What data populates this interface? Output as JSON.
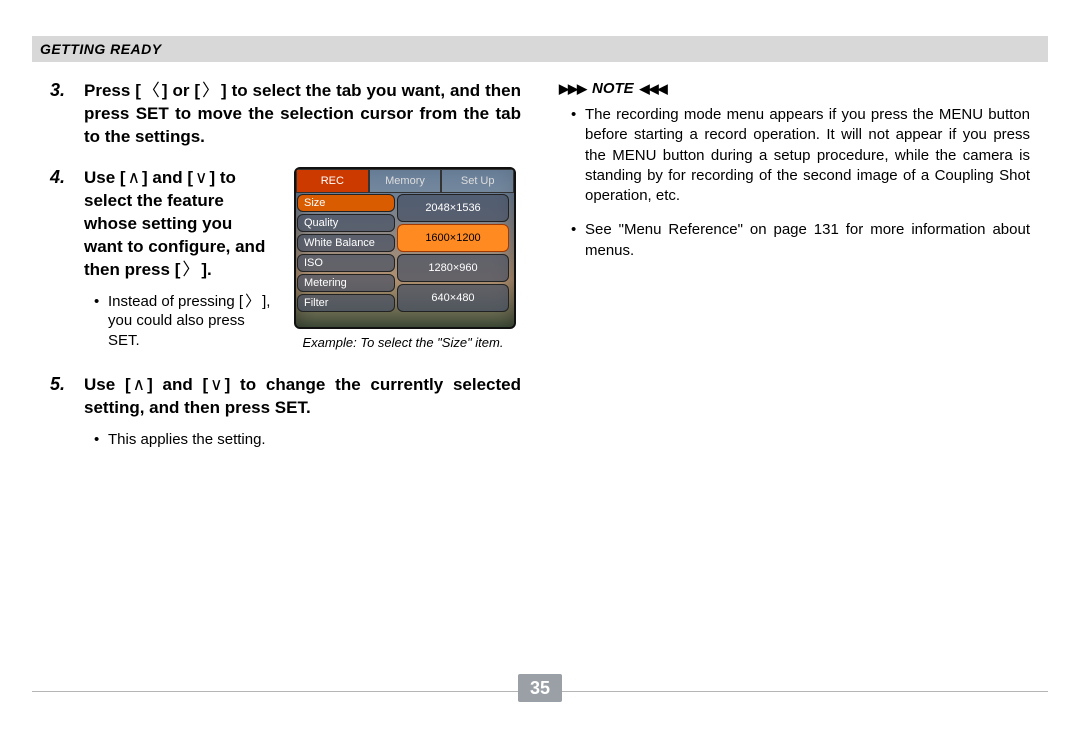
{
  "header": {
    "section_title": "GETTING READY"
  },
  "left": {
    "step3": {
      "num": "3.",
      "text_a": "Press [",
      "text_b": "] or [",
      "text_c": "] to select the tab you want, and then press SET to move the selection cursor from the tab to the settings."
    },
    "step4": {
      "num": "4.",
      "text_a": "Use [",
      "text_b": "] and [",
      "text_c": "] to select the feature whose setting you want to configure, and then press [",
      "text_d": "].",
      "sub_a": "Instead of pressing [",
      "sub_b": "], you could also press SET.",
      "caption": "Example: To select the \"Size\" item."
    },
    "step5": {
      "num": "5.",
      "text_a": "Use [",
      "text_b": "] and [",
      "text_c": "] to change the currently selected setting, and then press SET.",
      "sub": "This applies the setting."
    }
  },
  "lcd": {
    "tabs": [
      "REC",
      "Memory",
      "Set Up"
    ],
    "left_menu": [
      "Size",
      "Quality",
      "White Balance",
      "ISO",
      "Metering",
      "Filter"
    ],
    "right_menu": [
      "2048×1536",
      "1600×1200",
      "1280×960",
      "640×480"
    ]
  },
  "right": {
    "note_label": "NOTE",
    "note1": "The recording mode menu appears if you press the MENU button before starting a record operation. It will not appear if you press the MENU button during a setup procedure, while the camera is standing by for recording of the second image of a Coupling Shot operation, etc.",
    "note2": "See \"Menu Reference\" on page 131 for more information about menus."
  },
  "keys": {
    "left": "〈",
    "right": "〉",
    "up": "∧",
    "down": "∨"
  },
  "footer": {
    "page_number": "35"
  }
}
